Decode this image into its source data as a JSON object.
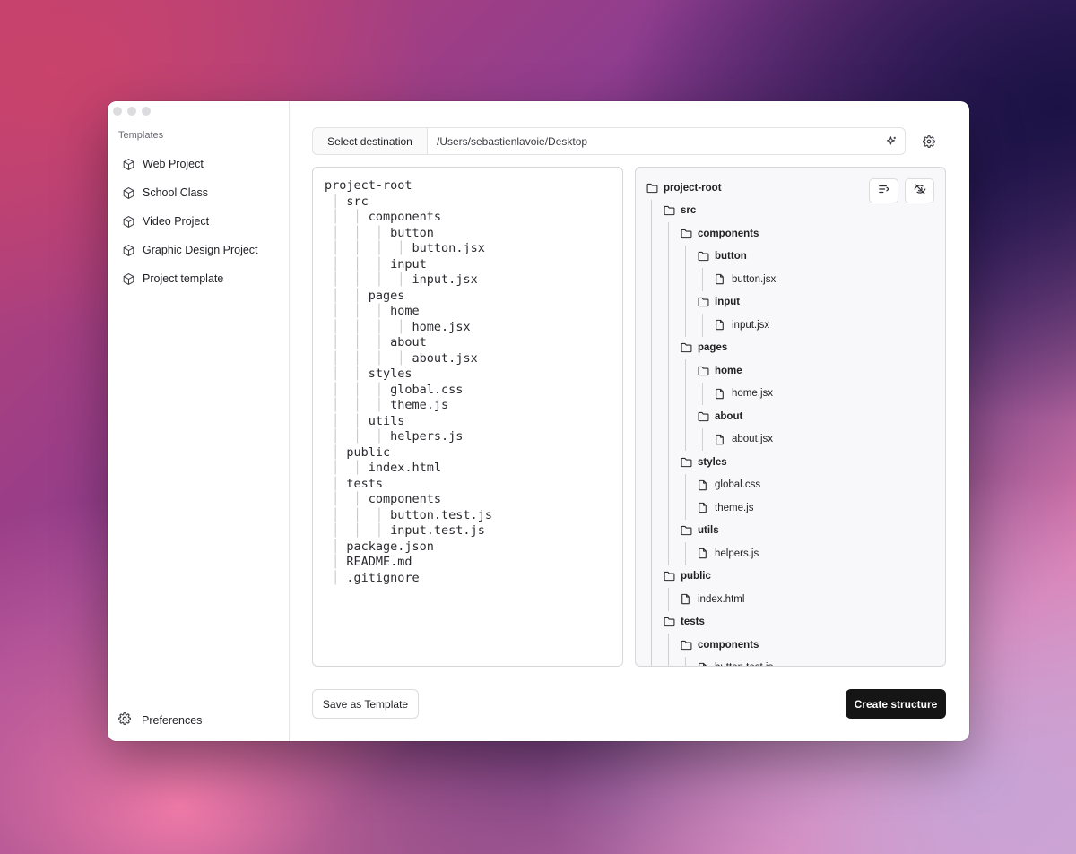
{
  "sidebar": {
    "section_title": "Templates",
    "items": [
      {
        "label": "Web Project",
        "icon": "cube-icon"
      },
      {
        "label": "School Class",
        "icon": "cube-icon"
      },
      {
        "label": "Video Project",
        "icon": "cube-icon"
      },
      {
        "label": "Graphic Design Project",
        "icon": "cube-icon"
      },
      {
        "label": "Project template",
        "icon": "cube-icon"
      }
    ],
    "footer_label": "Preferences"
  },
  "destination": {
    "button_label": "Select destination",
    "path": "/Users/sebastienlavoie/Desktop"
  },
  "editor": {
    "lines": [
      {
        "depth": 0,
        "name": "project-root"
      },
      {
        "depth": 1,
        "name": "src"
      },
      {
        "depth": 2,
        "name": "components"
      },
      {
        "depth": 3,
        "name": "button"
      },
      {
        "depth": 4,
        "name": "button.jsx"
      },
      {
        "depth": 3,
        "name": "input"
      },
      {
        "depth": 4,
        "name": "input.jsx"
      },
      {
        "depth": 2,
        "name": "pages"
      },
      {
        "depth": 3,
        "name": "home"
      },
      {
        "depth": 4,
        "name": "home.jsx"
      },
      {
        "depth": 3,
        "name": "about"
      },
      {
        "depth": 4,
        "name": "about.jsx"
      },
      {
        "depth": 2,
        "name": "styles"
      },
      {
        "depth": 3,
        "name": "global.css"
      },
      {
        "depth": 3,
        "name": "theme.js"
      },
      {
        "depth": 2,
        "name": "utils"
      },
      {
        "depth": 3,
        "name": "helpers.js"
      },
      {
        "depth": 1,
        "name": "public"
      },
      {
        "depth": 2,
        "name": "index.html"
      },
      {
        "depth": 1,
        "name": "tests"
      },
      {
        "depth": 2,
        "name": "components"
      },
      {
        "depth": 3,
        "name": "button.test.js"
      },
      {
        "depth": 3,
        "name": "input.test.js"
      },
      {
        "depth": 1,
        "name": "package.json"
      },
      {
        "depth": 1,
        "name": "README.md"
      },
      {
        "depth": 1,
        "name": ".gitignore"
      }
    ]
  },
  "preview": {
    "nodes": [
      {
        "depth": 0,
        "name": "project-root",
        "type": "folder"
      },
      {
        "depth": 1,
        "name": "src",
        "type": "folder"
      },
      {
        "depth": 2,
        "name": "components",
        "type": "folder"
      },
      {
        "depth": 3,
        "name": "button",
        "type": "folder"
      },
      {
        "depth": 4,
        "name": "button.jsx",
        "type": "file"
      },
      {
        "depth": 3,
        "name": "input",
        "type": "folder"
      },
      {
        "depth": 4,
        "name": "input.jsx",
        "type": "file"
      },
      {
        "depth": 2,
        "name": "pages",
        "type": "folder"
      },
      {
        "depth": 3,
        "name": "home",
        "type": "folder"
      },
      {
        "depth": 4,
        "name": "home.jsx",
        "type": "file"
      },
      {
        "depth": 3,
        "name": "about",
        "type": "folder"
      },
      {
        "depth": 4,
        "name": "about.jsx",
        "type": "file"
      },
      {
        "depth": 2,
        "name": "styles",
        "type": "folder"
      },
      {
        "depth": 3,
        "name": "global.css",
        "type": "file"
      },
      {
        "depth": 3,
        "name": "theme.js",
        "type": "file"
      },
      {
        "depth": 2,
        "name": "utils",
        "type": "folder"
      },
      {
        "depth": 3,
        "name": "helpers.js",
        "type": "file"
      },
      {
        "depth": 1,
        "name": "public",
        "type": "folder"
      },
      {
        "depth": 2,
        "name": "index.html",
        "type": "file"
      },
      {
        "depth": 1,
        "name": "tests",
        "type": "folder"
      },
      {
        "depth": 2,
        "name": "components",
        "type": "folder"
      },
      {
        "depth": 3,
        "name": "button.test.js",
        "type": "file"
      }
    ]
  },
  "footer": {
    "save_label": "Save as Template",
    "create_label": "Create structure"
  }
}
